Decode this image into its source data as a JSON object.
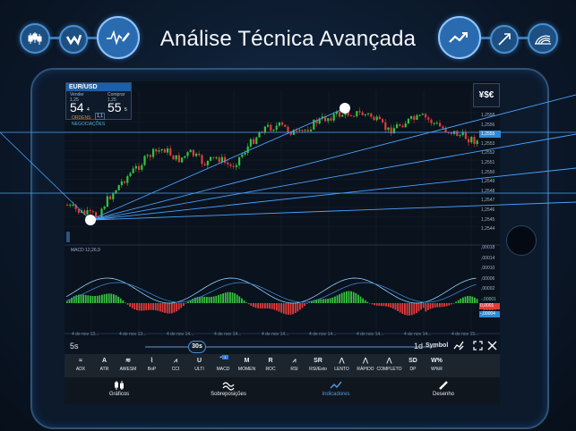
{
  "headline": "Análise Técnica Avançada",
  "quote": {
    "pair": "EUR/USD",
    "sell_label": "Vender",
    "sell_prefix": "1,25",
    "sell_big": "54",
    "sell_small": "4",
    "buy_label": "Comprar",
    "buy_prefix": "1,25",
    "buy_big": "55",
    "buy_small": "5",
    "spread": "1,1",
    "orders_label": "ORDENS",
    "trades_label": "NEGOCIAÇÕES"
  },
  "currency_button": "¥$€",
  "price_axis": [
    "1,2558",
    "1,2556",
    "1,2555",
    "1,2553",
    "1,2552",
    "1,2551",
    "1,2550",
    "1,2549",
    "1,2548",
    "1,2547",
    "1,2546",
    "1,2545",
    "1,2544"
  ],
  "current_price": "1,2555",
  "macd_label": "MACD 12,26,9",
  "macd_axis": [
    ",00018",
    ",00014",
    ",00010",
    ",00006",
    ",00002",
    "-,00001",
    "-,00004"
  ],
  "macd_badges": [
    "0,0001",
    "-,00004"
  ],
  "time_labels": [
    "4 de nov 13...",
    "4 de nov 13...",
    "4 de nov 14...",
    "4 de nov 14...",
    "4 de nov 14...",
    "4 de nov 14...",
    "4 de nov 14...",
    "4 de nov 14...",
    "4 de nov 15..."
  ],
  "timebar": {
    "left": "5s",
    "value": "30s",
    "right": "1d",
    "symbol": "Symbol"
  },
  "indicators": [
    {
      "icon": "≈",
      "label": "ADX"
    },
    {
      "icon": "A",
      "label": "ATR"
    },
    {
      "icon": "≋",
      "label": "AWESM"
    },
    {
      "icon": "⌇",
      "label": "BoP"
    },
    {
      "icon": "⩘",
      "label": "CCI"
    },
    {
      "icon": "U",
      "label": "ULTI"
    },
    {
      "icon": "⏜",
      "label": "MACD"
    },
    {
      "icon": "M",
      "label": "MOMEN"
    },
    {
      "icon": "R",
      "label": "ROC"
    },
    {
      "icon": "⩘",
      "label": "RSI"
    },
    {
      "icon": "SR",
      "label": "RSI/Esto"
    },
    {
      "icon": "⋀",
      "label": "LENTO"
    },
    {
      "icon": "⋀",
      "label": "RÁPIDO"
    },
    {
      "icon": "⋀",
      "label": "COMPLETO"
    },
    {
      "icon": "SD",
      "label": "DP"
    },
    {
      "icon": "W%",
      "label": "W%R"
    }
  ],
  "indicator_badge": "1",
  "bottom_tabs": [
    {
      "label": "Gráficos"
    },
    {
      "label": "Sobreposições"
    },
    {
      "label": "Indicadores"
    },
    {
      "label": "Desenho"
    }
  ],
  "colors": {
    "up": "#35c23c",
    "down": "#e23b3b",
    "accent": "#2f8ad8",
    "fan": "#4aa3ff"
  }
}
